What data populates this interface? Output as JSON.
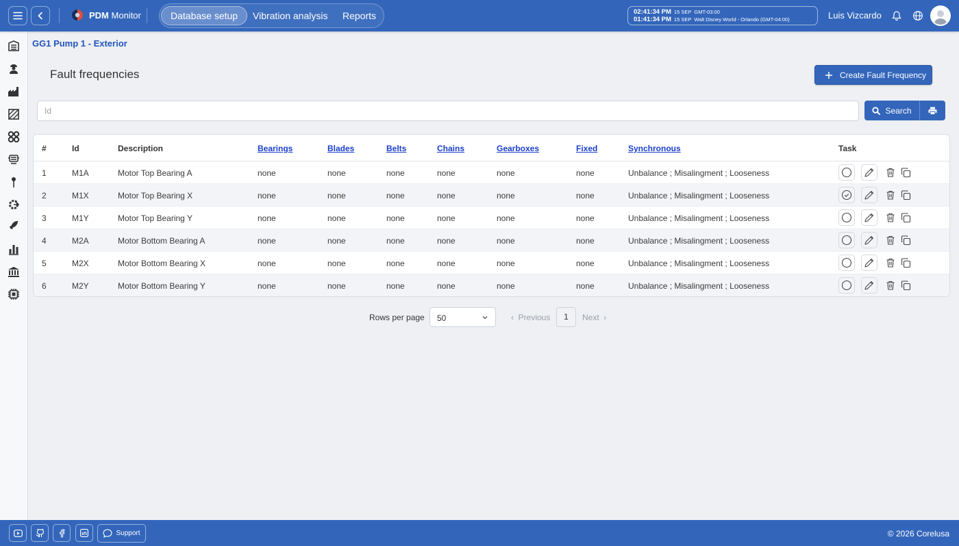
{
  "app": {
    "name_bold": "PDM",
    "name_rest": "Monitor"
  },
  "nav": {
    "tabs": [
      {
        "label": "Database setup",
        "active": true
      },
      {
        "label": "Vibration analysis",
        "active": false
      },
      {
        "label": "Reports",
        "active": false
      }
    ]
  },
  "clock": {
    "primary_time": "02:41:34 PM",
    "primary_date": "15 SEP",
    "primary_zone": "GMT-03:00",
    "secondary_time": "01:41:34 PM",
    "secondary_date": "15 SEP",
    "secondary_zone": "Walt Disney World - Orlando (GMT-04:00)"
  },
  "user": {
    "name": "Luis Vizcardo"
  },
  "sidebar": {
    "items": [
      {
        "icon": "building-icon"
      },
      {
        "icon": "worker-icon"
      },
      {
        "icon": "factory-icon"
      },
      {
        "icon": "hatched-area-icon"
      },
      {
        "icon": "gears-icon"
      },
      {
        "icon": "machine-icon"
      },
      {
        "icon": "pin-icon"
      },
      {
        "icon": "gear-arrow-icon"
      },
      {
        "icon": "rocket-icon"
      },
      {
        "icon": "bar-chart-icon"
      },
      {
        "icon": "bank-icon"
      },
      {
        "icon": "chip-icon"
      }
    ]
  },
  "page": {
    "breadcrumb": "GG1 Pump 1 - Exterior",
    "title": "Fault frequencies",
    "create_button": "Create Fault Frequency"
  },
  "search": {
    "placeholder": "Id",
    "value": "",
    "button": "Search"
  },
  "table": {
    "headers": {
      "num": "#",
      "id": "Id",
      "description": "Description",
      "bearings": "Bearings",
      "blades": "Blades",
      "belts": "Belts",
      "chains": "Chains",
      "gearboxes": "Gearboxes",
      "fixed": "Fixed",
      "synchronous": "Synchronous",
      "task": "Task"
    },
    "rows": [
      {
        "num": "1",
        "id": "M1A",
        "description": "Motor Top Bearing A",
        "bearings": "none",
        "blades": "none",
        "belts": "none",
        "chains": "none",
        "gearboxes": "none",
        "fixed": "none",
        "synchronous": "Unbalance ; Misalingment ; Looseness",
        "checked": false
      },
      {
        "num": "2",
        "id": "M1X",
        "description": "Motor Top Bearing X",
        "bearings": "none",
        "blades": "none",
        "belts": "none",
        "chains": "none",
        "gearboxes": "none",
        "fixed": "none",
        "synchronous": "Unbalance ; Misalingment ; Looseness",
        "checked": true
      },
      {
        "num": "3",
        "id": "M1Y",
        "description": "Motor Top Bearing Y",
        "bearings": "none",
        "blades": "none",
        "belts": "none",
        "chains": "none",
        "gearboxes": "none",
        "fixed": "none",
        "synchronous": "Unbalance ; Misalingment ; Looseness",
        "checked": false
      },
      {
        "num": "4",
        "id": "M2A",
        "description": "Motor Bottom Bearing A",
        "bearings": "none",
        "blades": "none",
        "belts": "none",
        "chains": "none",
        "gearboxes": "none",
        "fixed": "none",
        "synchronous": "Unbalance ; Misalingment ; Looseness",
        "checked": false
      },
      {
        "num": "5",
        "id": "M2X",
        "description": "Motor Bottom Bearing X",
        "bearings": "none",
        "blades": "none",
        "belts": "none",
        "chains": "none",
        "gearboxes": "none",
        "fixed": "none",
        "synchronous": "Unbalance ; Misalingment ; Looseness",
        "checked": false
      },
      {
        "num": "6",
        "id": "M2Y",
        "description": "Motor Bottom Bearing Y",
        "bearings": "none",
        "blades": "none",
        "belts": "none",
        "chains": "none",
        "gearboxes": "none",
        "fixed": "none",
        "synchronous": "Unbalance ; Misalingment ; Looseness",
        "checked": false
      }
    ]
  },
  "pagination": {
    "rows_per_page_label": "Rows per page",
    "rows_per_page_value": "50",
    "previous": "Previous",
    "current_page": "1",
    "next": "Next"
  },
  "footer": {
    "support": "Support",
    "copyright": "© 2026 Corelusa"
  },
  "colors": {
    "brand": "#3366bb",
    "link": "#1a3fcc",
    "breadcrumb": "#2255bb"
  }
}
